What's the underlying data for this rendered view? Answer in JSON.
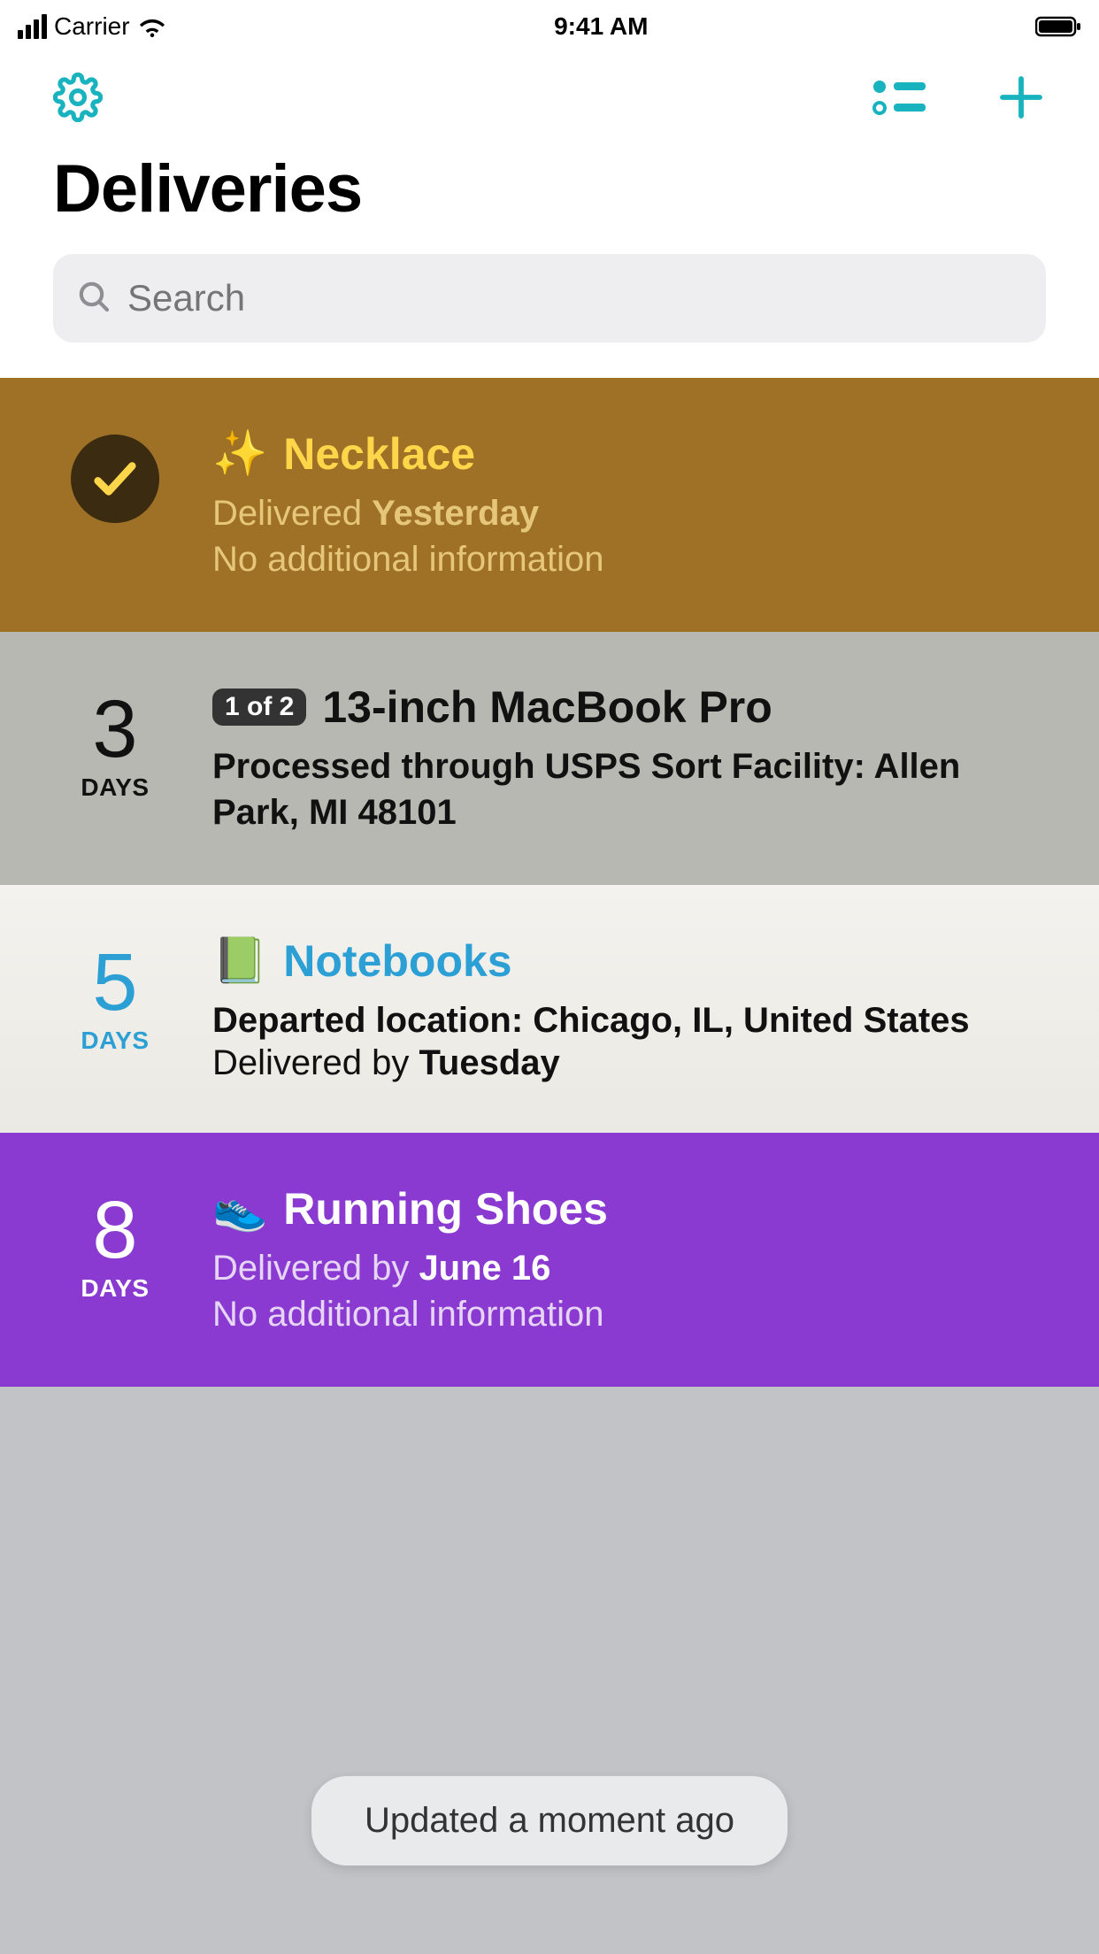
{
  "status": {
    "carrier": "Carrier",
    "time": "9:41 AM"
  },
  "header": {
    "title": "Deliveries"
  },
  "search": {
    "placeholder": "Search",
    "value": ""
  },
  "rows": [
    {
      "id": "necklace",
      "emoji": "✨",
      "title": "Necklace",
      "status_prefix": "Delivered ",
      "status_emph": "Yesterday",
      "extra": "No additional information"
    },
    {
      "id": "macbook",
      "count_num": "3",
      "count_label": "DAYS",
      "badge": "1 of 2",
      "title": "13-inch MacBook Pro",
      "status": "Processed through USPS Sort Facility: Allen Park, MI 48101"
    },
    {
      "id": "notebooks",
      "count_num": "5",
      "count_label": "DAYS",
      "emoji": "📗",
      "title": "Notebooks",
      "status": "Departed location: Chicago, IL, United States",
      "sub_prefix": "Delivered by ",
      "sub_emph": "Tuesday"
    },
    {
      "id": "shoes",
      "count_num": "8",
      "count_label": "DAYS",
      "emoji": "👟",
      "title": "Running Shoes",
      "status_prefix": "Delivered by ",
      "status_emph": "June 16",
      "extra": "No additional information"
    }
  ],
  "toast": "Updated a moment ago",
  "colors": {
    "accent": "#18B3BE",
    "necklace_bg": "#9e7127",
    "shoes_bg": "#8a3ad0",
    "notebooks_title": "#2ca0d5"
  }
}
